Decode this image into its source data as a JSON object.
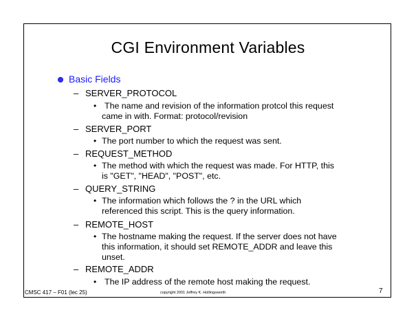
{
  "slide": {
    "title": "CGI Environment Variables",
    "section": "Basic Fields",
    "items": [
      {
        "name": "SERVER_PROTOCOL",
        "lines": [
          "The name and revision of the information protcol this request",
          "came in with. Format: protocol/revision"
        ]
      },
      {
        "name": "SERVER_PORT",
        "lines": [
          "The port number to which the request was sent."
        ]
      },
      {
        "name": "REQUEST_METHOD",
        "lines": [
          "The method with which the request was made. For HTTP, this",
          "is \"GET\", \"HEAD\", \"POST\", etc."
        ]
      },
      {
        "name": "QUERY_STRING",
        "lines": [
          "The information which follows the ? in the URL which",
          "referenced this script. This is the query information."
        ]
      },
      {
        "name": "REMOTE_HOST",
        "lines": [
          "The hostname making the request. If the server does not have",
          "this information, it should set REMOTE_ADDR and leave this",
          "unset."
        ]
      },
      {
        "name": "REMOTE_ADDR",
        "lines": [
          "The IP address of the remote host making the request."
        ]
      }
    ],
    "footer_left": "CMSC 417 – F01 (lec 25)",
    "footer_center": "copyright 2001 Jeffrey K. Hollingsworth",
    "page_number": "7"
  },
  "colors": {
    "section_text": "#1a1aff",
    "bullet": "#2f2fff"
  }
}
